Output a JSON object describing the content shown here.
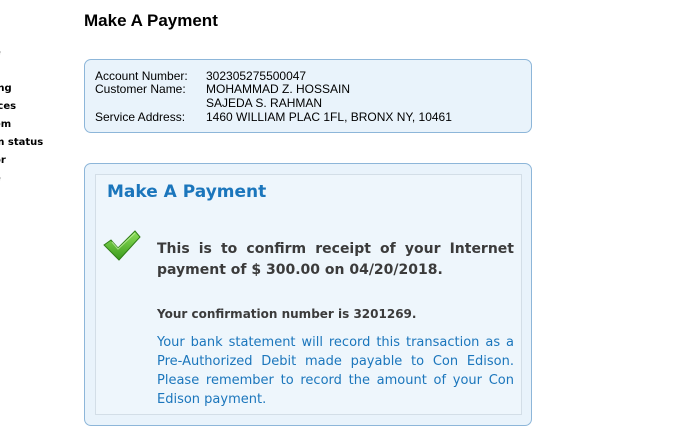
{
  "sidebar": {
    "items": [
      "e",
      "ing",
      "ices",
      "em",
      "m status",
      "or",
      "e",
      "s"
    ]
  },
  "page_title": "Make A Payment",
  "account": {
    "account_number_label": "Account Number:",
    "account_number": "302305275500047",
    "customer_name_label": "Customer Name:",
    "customer_name_1": "MOHAMMAD Z. HOSSAIN",
    "customer_name_2": "SAJEDA S. RAHMAN",
    "service_address_label": "Service Address:",
    "service_address": "1460 WILLIAM PLAC 1FL, BRONX NY, 10461"
  },
  "payment": {
    "heading": "Make A Payment",
    "status_icon": "checkmark-icon",
    "confirm_text": "This is to confirm receipt of your Internet payment of $ 300.00 on 04/20/2018.",
    "confirmation_text": "Your confirmation number is 3201269.",
    "bank_note": "Your bank statement will record this transaction as a Pre-Authorized Debit made payable to Con Edison. Please remember to record the amount of your Con Edison payment."
  },
  "colors": {
    "accent": "#1b76bc",
    "box_background": "#e9f3fb",
    "box_border": "#8db6d9",
    "check_green": "#4caf27"
  }
}
